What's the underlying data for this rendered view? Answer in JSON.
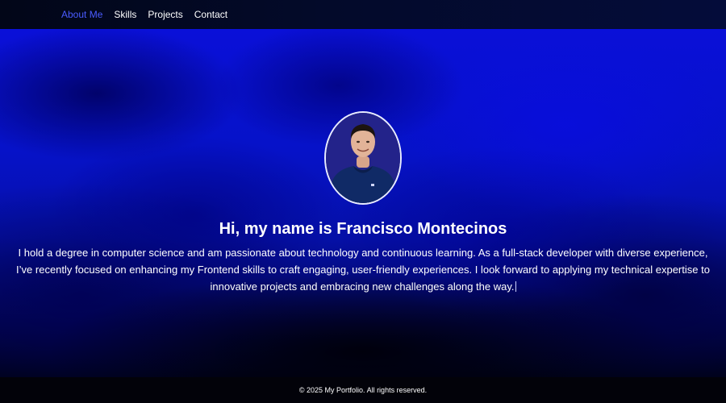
{
  "nav": {
    "items": [
      {
        "label": "About Me",
        "active": true
      },
      {
        "label": "Skills",
        "active": false
      },
      {
        "label": "Projects",
        "active": false
      },
      {
        "label": "Contact",
        "active": false
      }
    ],
    "active_color": "#4a5cff",
    "text_color": "#ffffff"
  },
  "hero": {
    "title": "Hi, my name is Francisco Montecinos",
    "description": "I hold a degree in computer science and am passionate about technology and continuous learning. As a full-stack developer with diverse experience, I’ve recently focused on enhancing my Frontend skills to craft engaging, user-friendly experiences. I look forward to applying my technical expertise to innovative projects and embracing new challenges along the way.",
    "background_color": "#0a10d8"
  },
  "footer": {
    "text": "© 2025 My Portfolio. All rights reserved."
  },
  "icons": {
    "avatar": "profile-photo"
  }
}
